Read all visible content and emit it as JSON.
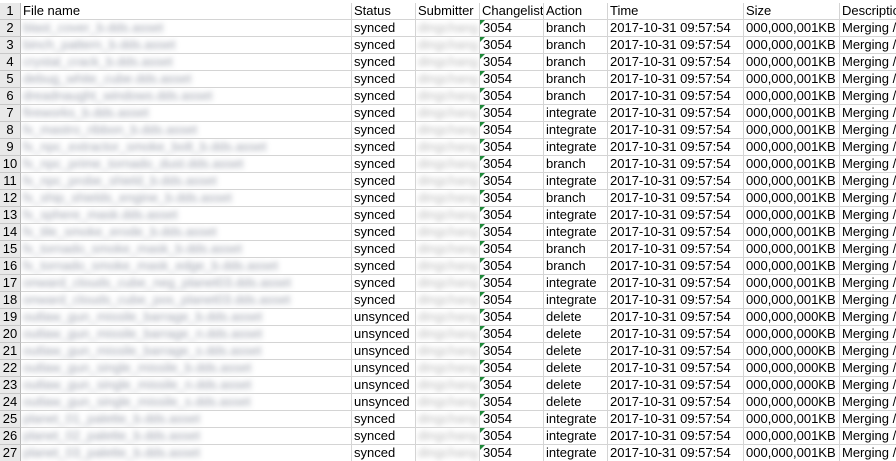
{
  "columns": {
    "a": "File name",
    "b": "Status",
    "c": "Submitter",
    "d": "Changelist",
    "e": "Action",
    "f": "Time",
    "g": "Size",
    "h": "Description"
  },
  "header_row_number": "1",
  "rows": [
    {
      "num": "2",
      "file": "blast_cover_b.dds.asset",
      "status": "synced",
      "submitter": "dingchang",
      "changelist": "3054",
      "action": "branch",
      "time": "2017-10-31 09:57:54",
      "size": "000,000,001KB",
      "desc": "Merging //"
    },
    {
      "num": "3",
      "file": "binch_pattern_b.dds.asset",
      "status": "synced",
      "submitter": "dingchang",
      "changelist": "3054",
      "action": "branch",
      "time": "2017-10-31 09:57:54",
      "size": "000,000,001KB",
      "desc": "Merging //"
    },
    {
      "num": "4",
      "file": "crystal_crack_b.dds.asset",
      "status": "synced",
      "submitter": "dingchang",
      "changelist": "3054",
      "action": "branch",
      "time": "2017-10-31 09:57:54",
      "size": "000,000,001KB",
      "desc": "Merging //"
    },
    {
      "num": "5",
      "file": "debug_white_cube.dds.asset",
      "status": "synced",
      "submitter": "dingchang",
      "changelist": "3054",
      "action": "branch",
      "time": "2017-10-31 09:57:54",
      "size": "000,000,001KB",
      "desc": "Merging //"
    },
    {
      "num": "6",
      "file": "dreadnaught_windows.dds.asset",
      "status": "synced",
      "submitter": "dingchang",
      "changelist": "3054",
      "action": "branch",
      "time": "2017-10-31 09:57:54",
      "size": "000,000,001KB",
      "desc": "Merging //"
    },
    {
      "num": "7",
      "file": "fireworks_b.dds.asset",
      "status": "synced",
      "submitter": "dingchang",
      "changelist": "3054",
      "action": "integrate",
      "time": "2017-10-31 09:57:54",
      "size": "000,000,001KB",
      "desc": "Merging //"
    },
    {
      "num": "8",
      "file": "fx_mastro_ribbon_b.dds.asset",
      "status": "synced",
      "submitter": "dingchang",
      "changelist": "3054",
      "action": "integrate",
      "time": "2017-10-31 09:57:54",
      "size": "000,000,001KB",
      "desc": "Merging //"
    },
    {
      "num": "9",
      "file": "fx_npc_extractor_smoke_bolt_b.dds.asset",
      "status": "synced",
      "submitter": "dingchang",
      "changelist": "3054",
      "action": "integrate",
      "time": "2017-10-31 09:57:54",
      "size": "000,000,001KB",
      "desc": "Merging //"
    },
    {
      "num": "10",
      "file": "fx_npc_prime_tornado_dust.dds.asset",
      "status": "synced",
      "submitter": "dingchang",
      "changelist": "3054",
      "action": "branch",
      "time": "2017-10-31 09:57:54",
      "size": "000,000,001KB",
      "desc": "Merging //"
    },
    {
      "num": "11",
      "file": "fx_npc_probe_shield_b.dds.asset",
      "status": "synced",
      "submitter": "dingchang",
      "changelist": "3054",
      "action": "integrate",
      "time": "2017-10-31 09:57:54",
      "size": "000,000,001KB",
      "desc": "Merging //"
    },
    {
      "num": "12",
      "file": "fx_ship_shields_engine_b.dds.asset",
      "status": "synced",
      "submitter": "dingchang",
      "changelist": "3054",
      "action": "branch",
      "time": "2017-10-31 09:57:54",
      "size": "000,000,001KB",
      "desc": "Merging //"
    },
    {
      "num": "13",
      "file": "fx_sphere_mask.dds.asset",
      "status": "synced",
      "submitter": "dingchang",
      "changelist": "3054",
      "action": "integrate",
      "time": "2017-10-31 09:57:54",
      "size": "000,000,001KB",
      "desc": "Merging //"
    },
    {
      "num": "14",
      "file": "fx_tile_smoke_erode_b.dds.asset",
      "status": "synced",
      "submitter": "dingchang",
      "changelist": "3054",
      "action": "integrate",
      "time": "2017-10-31 09:57:54",
      "size": "000,000,001KB",
      "desc": "Merging //"
    },
    {
      "num": "15",
      "file": "fx_tornado_smoke_mask_b.dds.asset",
      "status": "synced",
      "submitter": "dingchang",
      "changelist": "3054",
      "action": "branch",
      "time": "2017-10-31 09:57:54",
      "size": "000,000,001KB",
      "desc": "Merging //"
    },
    {
      "num": "16",
      "file": "fx_tornado_smoke_mask_edge_b.dds.asset",
      "status": "synced",
      "submitter": "dingchang",
      "changelist": "3054",
      "action": "branch",
      "time": "2017-10-31 09:57:54",
      "size": "000,000,001KB",
      "desc": "Merging //"
    },
    {
      "num": "17",
      "file": "onward_clouds_cube_neg_planet03.dds.asset",
      "status": "synced",
      "submitter": "dingchang",
      "changelist": "3054",
      "action": "integrate",
      "time": "2017-10-31 09:57:54",
      "size": "000,000,001KB",
      "desc": "Merging //"
    },
    {
      "num": "18",
      "file": "onward_clouds_cube_pos_planet03.dds.asset",
      "status": "synced",
      "submitter": "dingchang",
      "changelist": "3054",
      "action": "integrate",
      "time": "2017-10-31 09:57:54",
      "size": "000,000,001KB",
      "desc": "Merging //"
    },
    {
      "num": "19",
      "file": "outlaw_gun_missile_barrage_b.dds.asset",
      "status": "unsynced",
      "submitter": "dingchang",
      "changelist": "3054",
      "action": "delete",
      "time": "2017-10-31 09:57:54",
      "size": "000,000,000KB",
      "desc": "Merging //"
    },
    {
      "num": "20",
      "file": "outlaw_gun_missile_barrage_n.dds.asset",
      "status": "unsynced",
      "submitter": "dingchang",
      "changelist": "3054",
      "action": "delete",
      "time": "2017-10-31 09:57:54",
      "size": "000,000,000KB",
      "desc": "Merging //"
    },
    {
      "num": "21",
      "file": "outlaw_gun_missile_barrage_s.dds.asset",
      "status": "unsynced",
      "submitter": "dingchang",
      "changelist": "3054",
      "action": "delete",
      "time": "2017-10-31 09:57:54",
      "size": "000,000,000KB",
      "desc": "Merging //"
    },
    {
      "num": "22",
      "file": "outlaw_gun_single_missile_b.dds.asset",
      "status": "unsynced",
      "submitter": "dingchang",
      "changelist": "3054",
      "action": "delete",
      "time": "2017-10-31 09:57:54",
      "size": "000,000,000KB",
      "desc": "Merging //"
    },
    {
      "num": "23",
      "file": "outlaw_gun_single_missile_n.dds.asset",
      "status": "unsynced",
      "submitter": "dingchang",
      "changelist": "3054",
      "action": "delete",
      "time": "2017-10-31 09:57:54",
      "size": "000,000,000KB",
      "desc": "Merging //"
    },
    {
      "num": "24",
      "file": "outlaw_gun_single_missile_s.dds.asset",
      "status": "unsynced",
      "submitter": "dingchang",
      "changelist": "3054",
      "action": "delete",
      "time": "2017-10-31 09:57:54",
      "size": "000,000,000KB",
      "desc": "Merging //"
    },
    {
      "num": "25",
      "file": "planet_01_palette_b.dds.asset",
      "status": "synced",
      "submitter": "dingchang",
      "changelist": "3054",
      "action": "integrate",
      "time": "2017-10-31 09:57:54",
      "size": "000,000,001KB",
      "desc": "Merging //"
    },
    {
      "num": "26",
      "file": "planet_02_palette_b.dds.asset",
      "status": "synced",
      "submitter": "dingchang",
      "changelist": "3054",
      "action": "integrate",
      "time": "2017-10-31 09:57:54",
      "size": "000,000,001KB",
      "desc": "Merging //"
    },
    {
      "num": "27",
      "file": "planet_03_palette_b.dds.asset",
      "status": "synced",
      "submitter": "dingchang",
      "changelist": "3054",
      "action": "integrate",
      "time": "2017-10-31 09:57:54",
      "size": "000,000,001KB",
      "desc": "Merging //"
    }
  ],
  "colors": {
    "row_header_bg": "#e9e9e9",
    "grid_line": "#d4d4d4",
    "number_as_text_indicator": "#1f8a3a"
  },
  "icons": {
    "number_stored_as_text": "green-corner-triangle"
  }
}
